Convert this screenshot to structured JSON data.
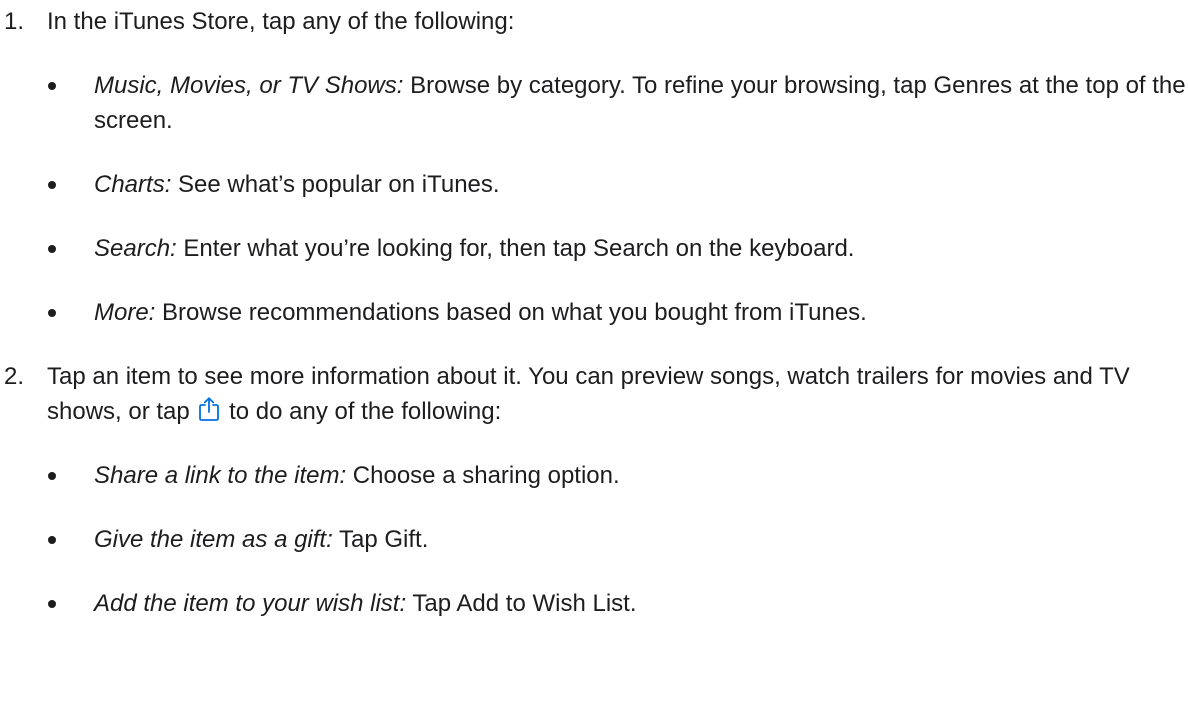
{
  "steps": [
    {
      "number": "1.",
      "text": "In the iTunes Store, tap any of the following:",
      "bullets": [
        {
          "lead": "Music, Movies, or TV Shows:",
          "text": " Browse by category. To refine your browsing, tap Genres at the top of the screen."
        },
        {
          "lead": "Charts:",
          "text": " See what’s popular on iTunes."
        },
        {
          "lead": "Search:",
          "text": " Enter what you’re looking for, then tap Search on the keyboard."
        },
        {
          "lead": "More:",
          "text": " Browse recommendations based on what you bought from iTunes."
        }
      ]
    },
    {
      "number": "2.",
      "text_before_icon": "Tap an item to see more information about it. You can preview songs, watch trailers for movies and TV shows, or tap ",
      "icon": "share-icon",
      "text_after_icon": " to do any of the following:",
      "bullets": [
        {
          "lead": "Share a link to the item:",
          "text": " Choose a sharing option."
        },
        {
          "lead": "Give the item as a gift:",
          "text": " Tap Gift."
        },
        {
          "lead": "Add the item to your wish list:",
          "text": " Tap Add to Wish List."
        }
      ]
    }
  ],
  "colors": {
    "text": "#1d1d1f",
    "icon_accent": "#0071e3"
  }
}
